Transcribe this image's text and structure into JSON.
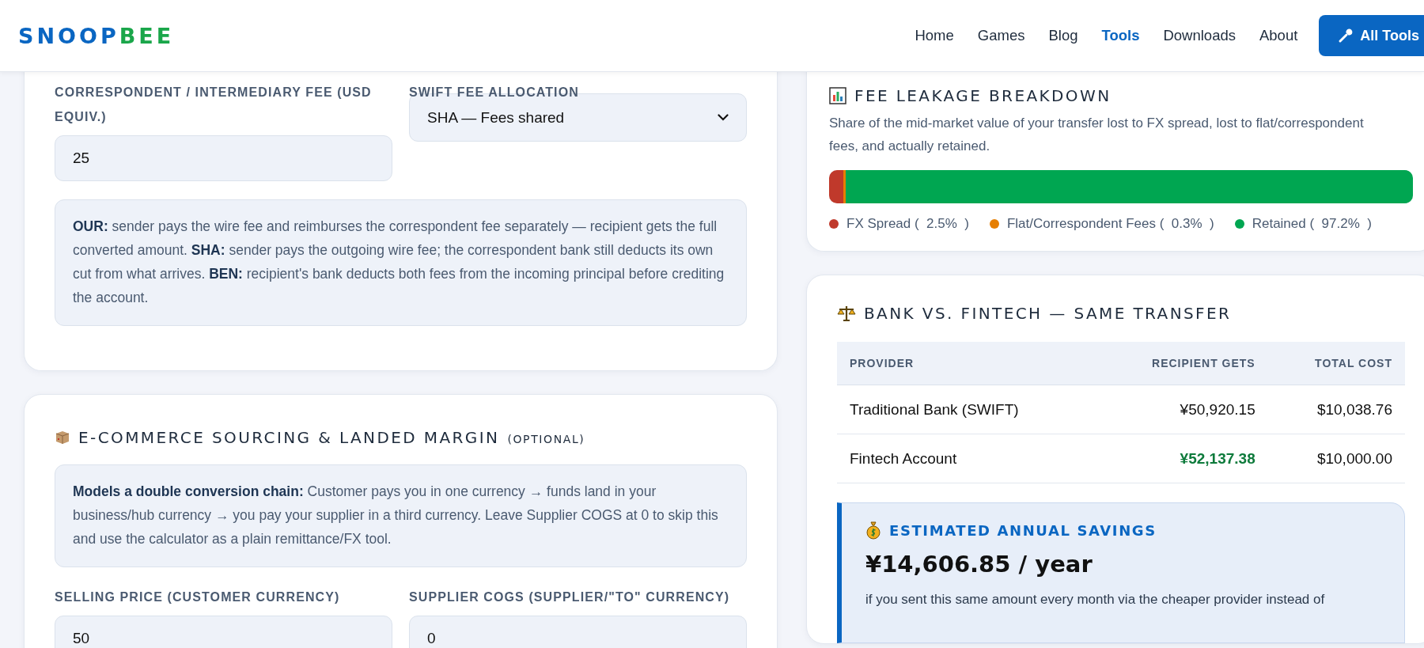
{
  "header": {
    "logo": [
      "SNOOP",
      "BEE"
    ],
    "nav": [
      {
        "label": "Home",
        "selected": false
      },
      {
        "label": "Games",
        "selected": false
      },
      {
        "label": "Blog",
        "selected": false
      },
      {
        "label": "Tools",
        "selected": true
      },
      {
        "label": "Downloads",
        "selected": false
      },
      {
        "label": "About",
        "selected": false
      }
    ],
    "cta": "All Tools"
  },
  "fee_card": {
    "fields": [
      {
        "kind": "input",
        "label": "CORRESPONDENT / INTERMEDIARY FEE (USD EQUIV.)",
        "value": "25"
      },
      {
        "kind": "select",
        "label": "SWIFT FEE ALLOCATION",
        "value": "SHA — Fees shared"
      }
    ],
    "note": "**OUR:** sender pays the wire fee and reimburses the correspondent fee separately — recipient gets the full converted amount. **SHA:** sender pays the outgoing wire fee; the correspondent bank still deducts its own cut from what arrives. **BEN:** recipient's bank deducts both fees from the incoming principal before crediting the account."
  },
  "ecommerce_card": {
    "title": "E-COMMERCE SOURCING & LANDED MARGIN",
    "tag": "(OPTIONAL)",
    "note": "**Models a double conversion chain:** Customer pays you in one currency → funds land in your business/hub currency → you pay your supplier in a third currency. Leave Supplier COGS at 0 to skip this and use the calculator as a plain remittance/FX tool.",
    "fields": [
      {
        "kind": "input",
        "label": "SELLING PRICE (CUSTOMER CURRENCY)",
        "value": "50"
      },
      {
        "kind": "input",
        "label": "SUPPLIER COGS (SUPPLIER/\"TO\" CURRENCY)",
        "value": "0"
      }
    ]
  },
  "leakage_card": {
    "title": "FEE LEAKAGE BREAKDOWN",
    "description": "Share of the mid-market value of your transfer lost to FX spread, lost to flat/correspondent fees, and actually retained.",
    "segments": [
      {
        "label": "FX Spread (  2.5%  )",
        "color": "#c0392b",
        "level": 0.025
      },
      {
        "label": "Flat/Correspondent Fees (  0.3%  )",
        "color": "#e67e00",
        "level": 0.003
      },
      {
        "label": "Retained (  97.2%  )",
        "color": "#00a651",
        "level": 0.972
      }
    ]
  },
  "comparison_card": {
    "title": "BANK VS. FINTECH — SAME TRANSFER",
    "table": {
      "columns": [
        "PROVIDER",
        "RECIPIENT GETS",
        "TOTAL COST"
      ],
      "rows": [
        {
          "cells": [
            {
              "text": "Traditional Bank (SWIFT)",
              "best": false
            },
            {
              "text": "¥50,920.15",
              "best": false
            },
            {
              "text": "$10,038.76",
              "best": false
            }
          ]
        },
        {
          "cells": [
            {
              "text": "Fintech Account",
              "best": false
            },
            {
              "text": "¥52,137.38",
              "best": true
            },
            {
              "text": "$10,000.00",
              "best": false
            }
          ]
        }
      ]
    },
    "savings": {
      "title": "ESTIMATED ANNUAL SAVINGS",
      "amount": "¥14,606.85 / year",
      "text": "if you sent this same amount every month via the cheaper provider instead of"
    }
  }
}
